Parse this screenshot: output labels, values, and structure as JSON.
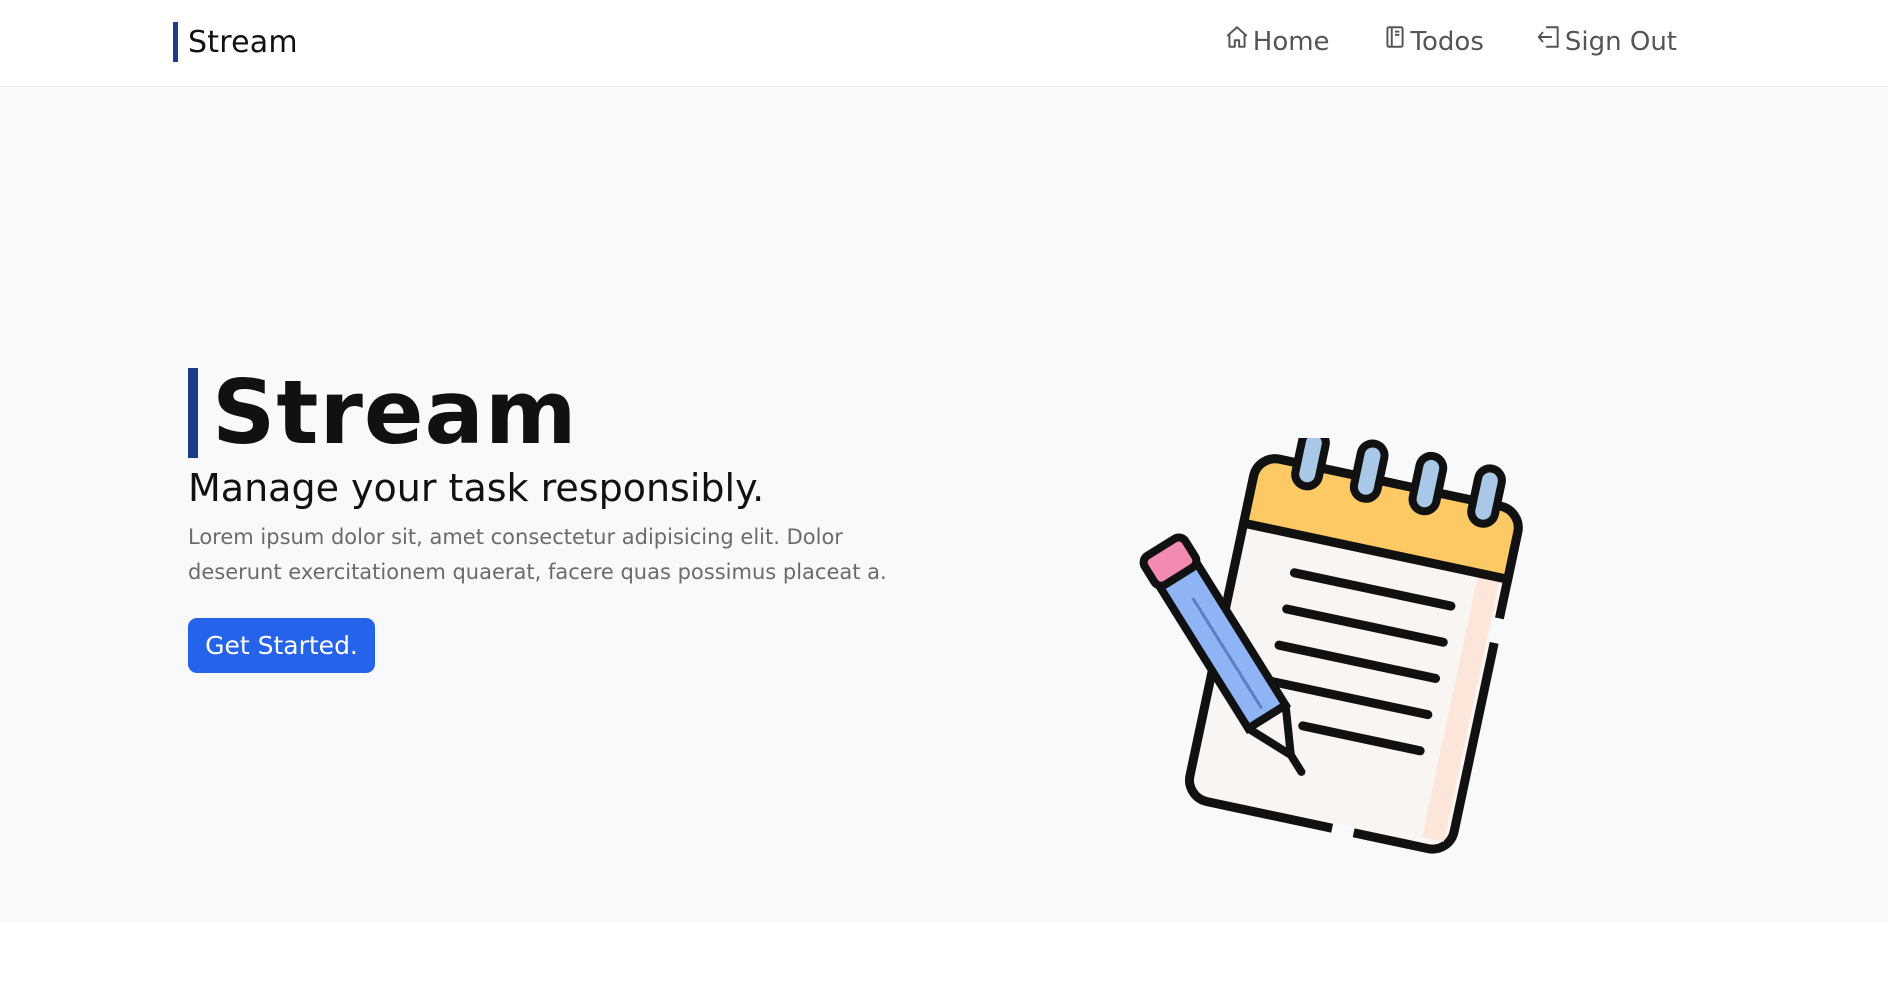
{
  "nav": {
    "brand": "Stream",
    "links": [
      {
        "label": "Home",
        "icon": "home-icon"
      },
      {
        "label": "Todos",
        "icon": "book-icon"
      },
      {
        "label": "Sign Out",
        "icon": "sign-out-icon"
      }
    ]
  },
  "hero": {
    "title": "Stream",
    "subtitle": "Manage your task responsibly.",
    "description": "Lorem ipsum dolor sit, amet consectetur adipisicing elit. Dolor deserunt exercitationem quaerat, facere quas possimus placeat a.",
    "cta_label": "Get Started.",
    "illustration_icon": "notepad-pencil-icon"
  },
  "colors": {
    "accent_bar": "#1e3a8a",
    "cta": "#2563eb",
    "hero_bg": "#f8f9fb",
    "notepad_top": "#fcc964",
    "pencil_body": "#8fb4f5",
    "eraser": "#f28ab2"
  }
}
